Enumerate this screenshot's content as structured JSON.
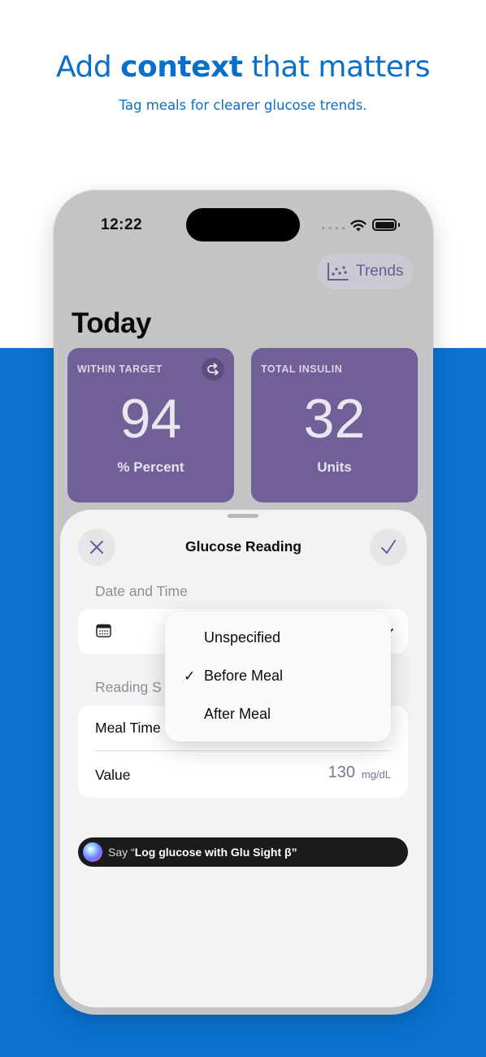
{
  "promo": {
    "headline_pre": "Add ",
    "headline_bold": "context",
    "headline_post": " that matters",
    "subtitle": "Tag meals for clearer glucose trends."
  },
  "status_bar": {
    "time": "12:22",
    "icons": [
      "cellular-icon",
      "wifi-icon",
      "battery-icon"
    ]
  },
  "header": {
    "trends_label": "Trends",
    "title": "Today"
  },
  "cards": [
    {
      "title": "WITHIN TARGET",
      "value": "94",
      "unit": "% Percent"
    },
    {
      "title": "TOTAL INSULIN",
      "value": "32",
      "unit": "Units"
    }
  ],
  "sheet": {
    "title": "Glucose Reading",
    "date_section_label": "Date and Time",
    "reading_section_label": "Reading S",
    "meal_time_label": "Meal Time",
    "value_label": "Value",
    "value": "130",
    "value_unit": "mg/dL"
  },
  "meal_menu": {
    "options": [
      "Unspecified",
      "Before Meal",
      "After Meal"
    ],
    "selected": "Before Meal"
  },
  "siri": {
    "prefix": "Say “",
    "command": "Log glucose with Glu Sight β",
    "suffix": "”"
  },
  "colors": {
    "accent": "#715f97",
    "promo_blue": "#0a73d2"
  }
}
